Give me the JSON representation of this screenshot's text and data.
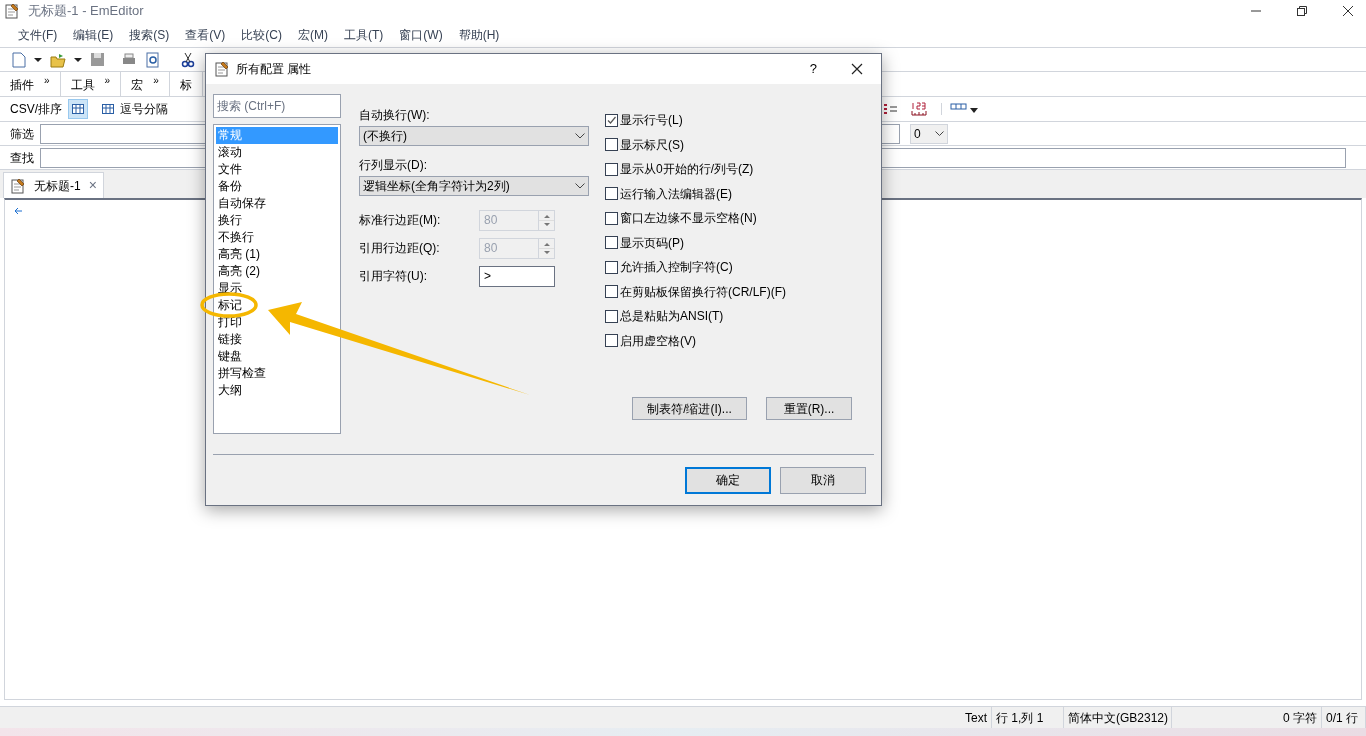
{
  "window": {
    "title": "无标题-1 - EmEditor"
  },
  "menu": [
    "文件(F)",
    "编辑(E)",
    "搜索(S)",
    "查看(V)",
    "比较(C)",
    "宏(M)",
    "工具(T)",
    "窗口(W)",
    "帮助(H)"
  ],
  "toolbars": [
    {
      "label": "插件",
      "chevron": "»"
    },
    {
      "label": "工具",
      "chevron": "»"
    },
    {
      "label": "宏",
      "chevron": "»"
    },
    {
      "label": "标"
    }
  ],
  "csv_bar": {
    "label": "CSV/排序",
    "buttons": [
      "逗号分隔"
    ]
  },
  "filter": {
    "label": "筛选",
    "number": "0"
  },
  "find": {
    "label": "查找"
  },
  "tab": {
    "title": "无标题-1",
    "close": "×"
  },
  "status_bar": [
    "Text",
    "行 1,列 1",
    "简体中文(GB2312)",
    "0 字符",
    "0/1 行"
  ],
  "dialog": {
    "title": "所有配置 属性",
    "help": "?",
    "search": {
      "placeholder": "搜索 (Ctrl+F)"
    },
    "categories": [
      {
        "label": "常规",
        "selected": true
      },
      {
        "label": "滚动",
        "selected": false
      },
      {
        "label": "文件",
        "selected": false
      },
      {
        "label": "备份",
        "selected": false
      },
      {
        "label": "自动保存",
        "selected": false
      },
      {
        "label": "换行",
        "selected": false
      },
      {
        "label": "不换行",
        "selected": false
      },
      {
        "label": "高亮 (1)",
        "selected": false
      },
      {
        "label": "高亮 (2)",
        "selected": false
      },
      {
        "label": "显示",
        "selected": false
      },
      {
        "label": "标记",
        "selected": false
      },
      {
        "label": "打印",
        "selected": false
      },
      {
        "label": "链接",
        "selected": false
      },
      {
        "label": "键盘",
        "selected": false
      },
      {
        "label": "拼写检查",
        "selected": false
      },
      {
        "label": "大纲",
        "selected": false
      }
    ],
    "dropdowns": [
      {
        "label": "自动换行(W):",
        "value": "(不换行)"
      },
      {
        "label": "行列显示(D):",
        "value": "逻辑坐标(全角字符计为2列)"
      }
    ],
    "fields": [
      {
        "kind": "spin",
        "label": "标准行边距(M):",
        "value": "80",
        "disabled": true
      },
      {
        "kind": "spin",
        "label": "引用行边距(Q):",
        "value": "80",
        "disabled": true
      },
      {
        "kind": "text",
        "label": "引用字符(U):",
        "value": ">",
        "disabled": false
      }
    ],
    "checkboxes": [
      {
        "label": "显示行号(L)",
        "checked": true
      },
      {
        "label": "显示标尺(S)",
        "checked": false
      },
      {
        "label": "显示从0开始的行/列号(Z)",
        "checked": false
      },
      {
        "label": "运行输入法编辑器(E)",
        "checked": false
      },
      {
        "label": "窗口左边缘不显示空格(N)",
        "checked": false
      },
      {
        "label": "显示页码(P)",
        "checked": false
      },
      {
        "label": "允许插入控制字符(C)",
        "checked": false
      },
      {
        "label": "在剪贴板保留换行符(CR/LF)(F)",
        "checked": false
      },
      {
        "label": "总是粘贴为ANSI(T)",
        "checked": false
      },
      {
        "label": "启用虚空格(V)",
        "checked": false
      }
    ],
    "side_buttons": [
      "制表符/缩进(I)...",
      "重置(R)..."
    ],
    "buttons": [
      {
        "label": "确定",
        "default": true
      },
      {
        "label": "取消",
        "default": false
      }
    ]
  }
}
